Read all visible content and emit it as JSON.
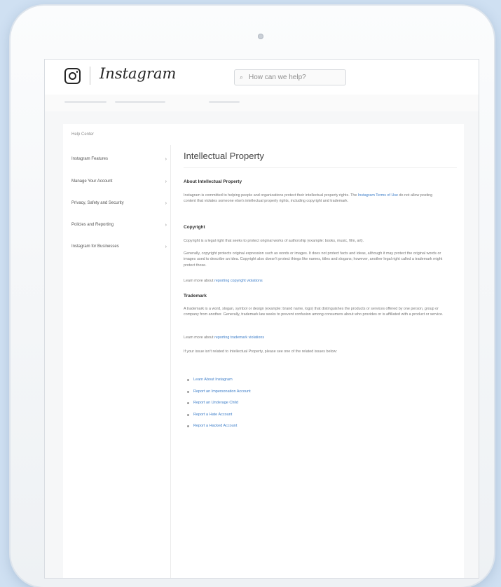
{
  "header": {
    "brand": "Instagram",
    "search_placeholder": "How can we help?"
  },
  "breadcrumb": "Help Center",
  "sidebar": {
    "items": [
      {
        "label": "Instagram Features"
      },
      {
        "label": "Manage Your Account"
      },
      {
        "label": "Privacy, Safety and Security"
      },
      {
        "label": "Policies and Reporting"
      },
      {
        "label": "Instagram for Businesses"
      }
    ],
    "chevron": "›"
  },
  "article": {
    "title": "Intellectual Property",
    "sections": {
      "about_heading": "About Intellectual Property",
      "about_text_1": "Instagram is committed to helping people and organizations protect their intellectual property rights. The",
      "about_link": "Instagram Terms of Use",
      "about_text_2": "do not allow posting content that violates someone else's intellectual property rights, including copyright and trademark.",
      "copyright_heading": "Copyright",
      "copyright_p1": "Copyright is a legal right that seeks to protect original works of authorship (example: books, music, film, art).",
      "copyright_p2": "Generally, copyright protects original expression such as words or images. It does not protect facts and ideas, although it may protect the original words or images used to describe an idea. Copyright also doesn't protect things like names, titles and slogans; however, another legal right called a trademark might protect those.",
      "copyright_more_text": "Learn more about",
      "copyright_more_link": "reporting copyright violations",
      "trademark_heading": "Trademark",
      "trademark_p1": "A trademark is a word, slogan, symbol or design (example: brand name, logo) that distinguishes the products or services offered by one person, group or company from another. Generally, trademark law seeks to prevent confusion among consumers about who provides or is affiliated with a product or service.",
      "trademark_more_text": "Learn more about",
      "trademark_more_link": "reporting trademark violations",
      "report_intro": "If your issue isn't related to Intellectual Property, please see one of the related issues below:"
    },
    "links": [
      "Learn About Instagram",
      "Report an Impersonation Account",
      "Report an Underage Child",
      "Report a Hate Account",
      "Report a Hacked Account"
    ]
  }
}
